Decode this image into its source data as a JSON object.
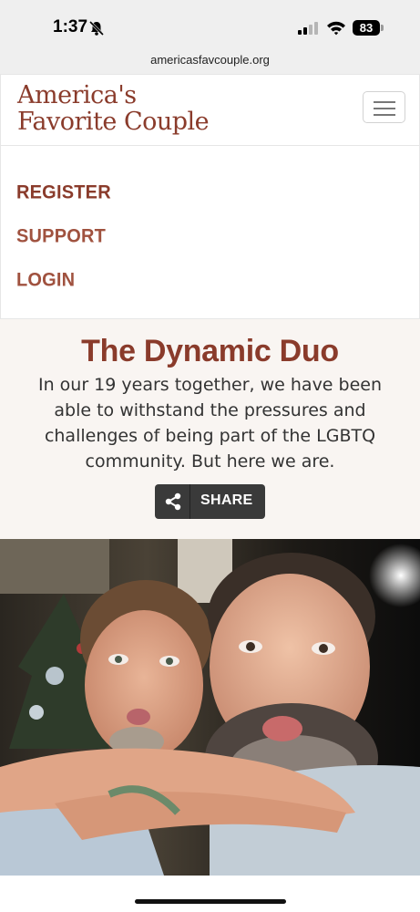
{
  "status_bar": {
    "time": "1:37",
    "battery": "83",
    "icons": [
      "bell-slash-icon",
      "signal-icon",
      "wifi-icon",
      "battery-icon"
    ]
  },
  "browser": {
    "url": "americasfavcouple.org"
  },
  "header": {
    "logo_line1": "America's",
    "logo_line2": "Favorite Couple",
    "menu_icon": "hamburger-menu-icon"
  },
  "nav": {
    "items": [
      {
        "label": "REGISTER"
      },
      {
        "label": "SUPPORT"
      },
      {
        "label": "LOGIN"
      }
    ]
  },
  "hero": {
    "title": "The Dynamic Duo",
    "text": "In our 19 years together, we have been able to withstand the pressures and challenges of being part of the LGBTQ community. But here we are.",
    "share_label": "SHARE",
    "share_icon": "share-icon"
  },
  "colors": {
    "brand": "#8a3b2b",
    "hero_bg": "#f9f5f2",
    "share_bg": "#3a3a3a"
  }
}
